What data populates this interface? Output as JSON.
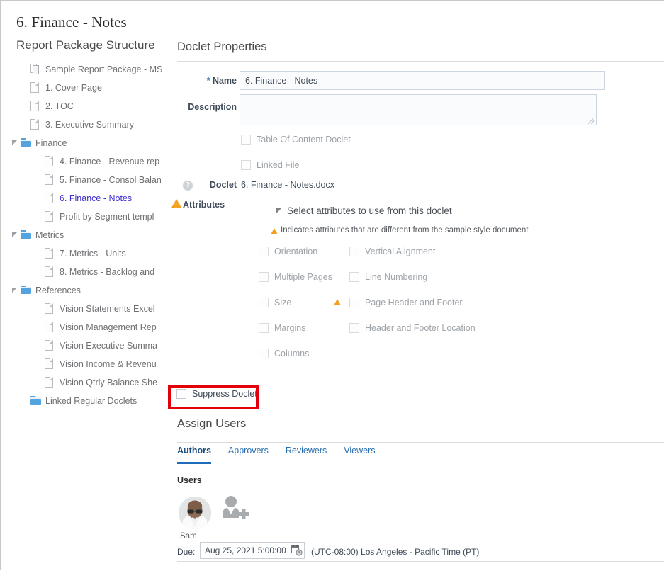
{
  "page": {
    "title": "6. Finance - Notes"
  },
  "sidebar": {
    "title": "Report Package Structure",
    "tree": [
      {
        "label": "Sample Report Package - MS",
        "icon": "stacked-documents-icon",
        "indent": 1,
        "type": "doc-stack",
        "twisty": false,
        "selected": false
      },
      {
        "label": "1. Cover Page",
        "icon": "document-icon",
        "indent": 1,
        "type": "doc",
        "twisty": false,
        "selected": false
      },
      {
        "label": "2. TOC",
        "icon": "document-icon",
        "indent": 1,
        "type": "doc",
        "twisty": false,
        "selected": false
      },
      {
        "label": "3. Executive Summary",
        "icon": "document-icon",
        "indent": 1,
        "type": "doc",
        "twisty": false,
        "selected": false
      },
      {
        "label": "Finance",
        "icon": "folder-icon",
        "indent": 0,
        "type": "folder",
        "twisty": true,
        "selected": false
      },
      {
        "label": "4. Finance - Revenue rep",
        "icon": "document-icon",
        "indent": 2,
        "type": "doc",
        "twisty": false,
        "selected": false
      },
      {
        "label": "5. Finance - Consol Balan",
        "icon": "document-icon",
        "indent": 2,
        "type": "doc",
        "twisty": false,
        "selected": false
      },
      {
        "label": "6. Finance - Notes",
        "icon": "document-icon",
        "indent": 2,
        "type": "doc",
        "twisty": false,
        "selected": true
      },
      {
        "label": "Profit by Segment templ",
        "icon": "document-icon",
        "indent": 2,
        "type": "doc",
        "twisty": false,
        "selected": false
      },
      {
        "label": "Metrics",
        "icon": "folder-icon",
        "indent": 0,
        "type": "folder",
        "twisty": true,
        "selected": false
      },
      {
        "label": "7. Metrics - Units",
        "icon": "document-icon",
        "indent": 2,
        "type": "doc",
        "twisty": false,
        "selected": false
      },
      {
        "label": "8. Metrics - Backlog and",
        "icon": "document-icon",
        "indent": 2,
        "type": "doc",
        "twisty": false,
        "selected": false
      },
      {
        "label": "References",
        "icon": "folder-icon",
        "indent": 0,
        "type": "folder",
        "twisty": true,
        "selected": false
      },
      {
        "label": "Vision Statements Excel",
        "icon": "document-icon",
        "indent": 2,
        "type": "doc",
        "twisty": false,
        "selected": false
      },
      {
        "label": "Vision Management Rep",
        "icon": "document-icon",
        "indent": 2,
        "type": "doc",
        "twisty": false,
        "selected": false
      },
      {
        "label": "Vision Executive Summa",
        "icon": "document-icon",
        "indent": 2,
        "type": "doc",
        "twisty": false,
        "selected": false
      },
      {
        "label": "Vision Income & Revenu",
        "icon": "document-icon",
        "indent": 2,
        "type": "doc",
        "twisty": false,
        "selected": false
      },
      {
        "label": "Vision Qtrly Balance She",
        "icon": "document-icon",
        "indent": 2,
        "type": "doc",
        "twisty": false,
        "selected": false
      },
      {
        "label": "Linked Regular Doclets",
        "icon": "folder-icon",
        "indent": 1,
        "type": "folder",
        "twisty": false,
        "selected": false
      }
    ]
  },
  "properties": {
    "heading": "Doclet Properties",
    "name_label": "Name",
    "name_required_mark": "*",
    "name_value": "6. Finance - Notes",
    "description_label": "Description",
    "description_value": "",
    "description_placeholder": "",
    "toc_doclet_label": "Table Of Content Doclet",
    "toc_doclet_checked": false,
    "linked_file_label": "Linked File",
    "linked_file_checked": false,
    "doclet_label": "Doclet",
    "doclet_value": "6. Finance - Notes.docx",
    "help_icon_glyph": "?"
  },
  "attributes": {
    "label": "Attributes",
    "select_heading": "Select attributes to use from this doclet",
    "legend": "Indicates attributes that are different from the sample style document",
    "items_left": [
      {
        "label": "Orientation",
        "checked": false,
        "warn": false
      },
      {
        "label": "Multiple Pages",
        "checked": false,
        "warn": false
      },
      {
        "label": "Size",
        "checked": false,
        "warn": true
      },
      {
        "label": "Margins",
        "checked": false,
        "warn": false
      },
      {
        "label": "Columns",
        "checked": false,
        "warn": false
      }
    ],
    "items_right": [
      {
        "label": "Vertical Alignment",
        "checked": false,
        "warn": false
      },
      {
        "label": "Line Numbering",
        "checked": false,
        "warn": false
      },
      {
        "label": "Page Header and Footer",
        "checked": false,
        "warn": false
      },
      {
        "label": "Header and Footer Location",
        "checked": false,
        "warn": false
      }
    ]
  },
  "suppress": {
    "label": "Suppress Doclet",
    "checked": false,
    "highlight_color": "#e3000b"
  },
  "assign_users": {
    "heading": "Assign Users",
    "tabs": [
      {
        "label": "Authors",
        "active": true
      },
      {
        "label": "Approvers",
        "active": false
      },
      {
        "label": "Reviewers",
        "active": false
      },
      {
        "label": "Viewers",
        "active": false
      }
    ],
    "users_header": "Users",
    "users": [
      {
        "name": "Sam",
        "avatar": "user-photo"
      }
    ],
    "add_user_icon": "add-user-icon",
    "due_label": "Due:",
    "due_value": "Aug 25, 2021 5:00:00 PM",
    "due_calendar_icon": "calendar-clock-icon",
    "timezone": "(UTC-08:00) Los Angeles - Pacific Time (PT)"
  },
  "colors": {
    "accent": "#1e6bb8",
    "link": "#2a6fb0",
    "selected_tree": "#3b2ed0",
    "warning": "#f2a01e",
    "highlight": "#e3000b",
    "folder": "#52a3de"
  }
}
